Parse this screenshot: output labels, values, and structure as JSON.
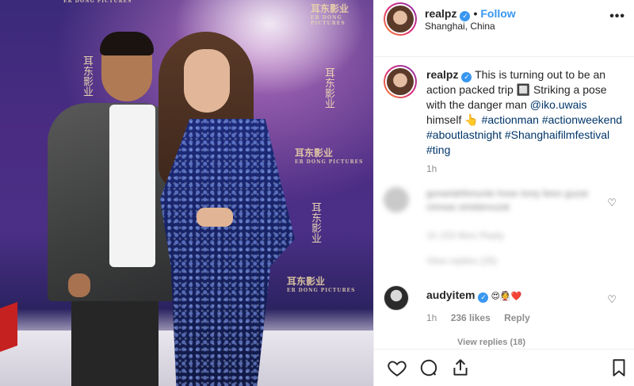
{
  "photo": {
    "wall_logos": [
      "耳东影业",
      "耳东影业",
      "耳东影业",
      "耳东影业"
    ],
    "wall_logo_subtitle": "ER DONG PICTURES",
    "calligraphy": "耳东影业"
  },
  "header": {
    "username": "realpz",
    "verified_mark": "✓",
    "separator": "•",
    "follow_label": "Follow",
    "location": "Shanghai, China",
    "more_label": "•••"
  },
  "caption": {
    "username": "realpz",
    "text_1": "This is turning out to be an action packed trip",
    "text_2": "Striking a pose with the danger man",
    "mention": "@iko.uwais",
    "text_3": "himself",
    "emoji_1": "🔲",
    "emoji_2": "👆",
    "hashtags": [
      "#actionman",
      "#actionweekend",
      "#aboutlastnight",
      "#Shanghaifilmfestival",
      "#ting"
    ],
    "time": "1h"
  },
  "comments": {
    "blurred_1_text": "gunarlahfonunle hose ismy liesn guzar cimsas sinidarvuzat",
    "blurred_1_meta": "1h   153 likes   Reply",
    "blurred_1_replies": "View replies (26)",
    "audy": {
      "username": "audyitem",
      "emojis": "😍👰❤️",
      "time": "1h",
      "likes": "236 likes",
      "reply": "Reply",
      "view_replies": "View replies (18)"
    }
  },
  "colors": {
    "link": "#003569",
    "follow": "#3897f0",
    "muted": "#8e8e8e"
  },
  "icons": [
    "heart-icon",
    "comment-icon",
    "share-icon",
    "bookmark-icon",
    "more-icon",
    "verified-icon"
  ]
}
